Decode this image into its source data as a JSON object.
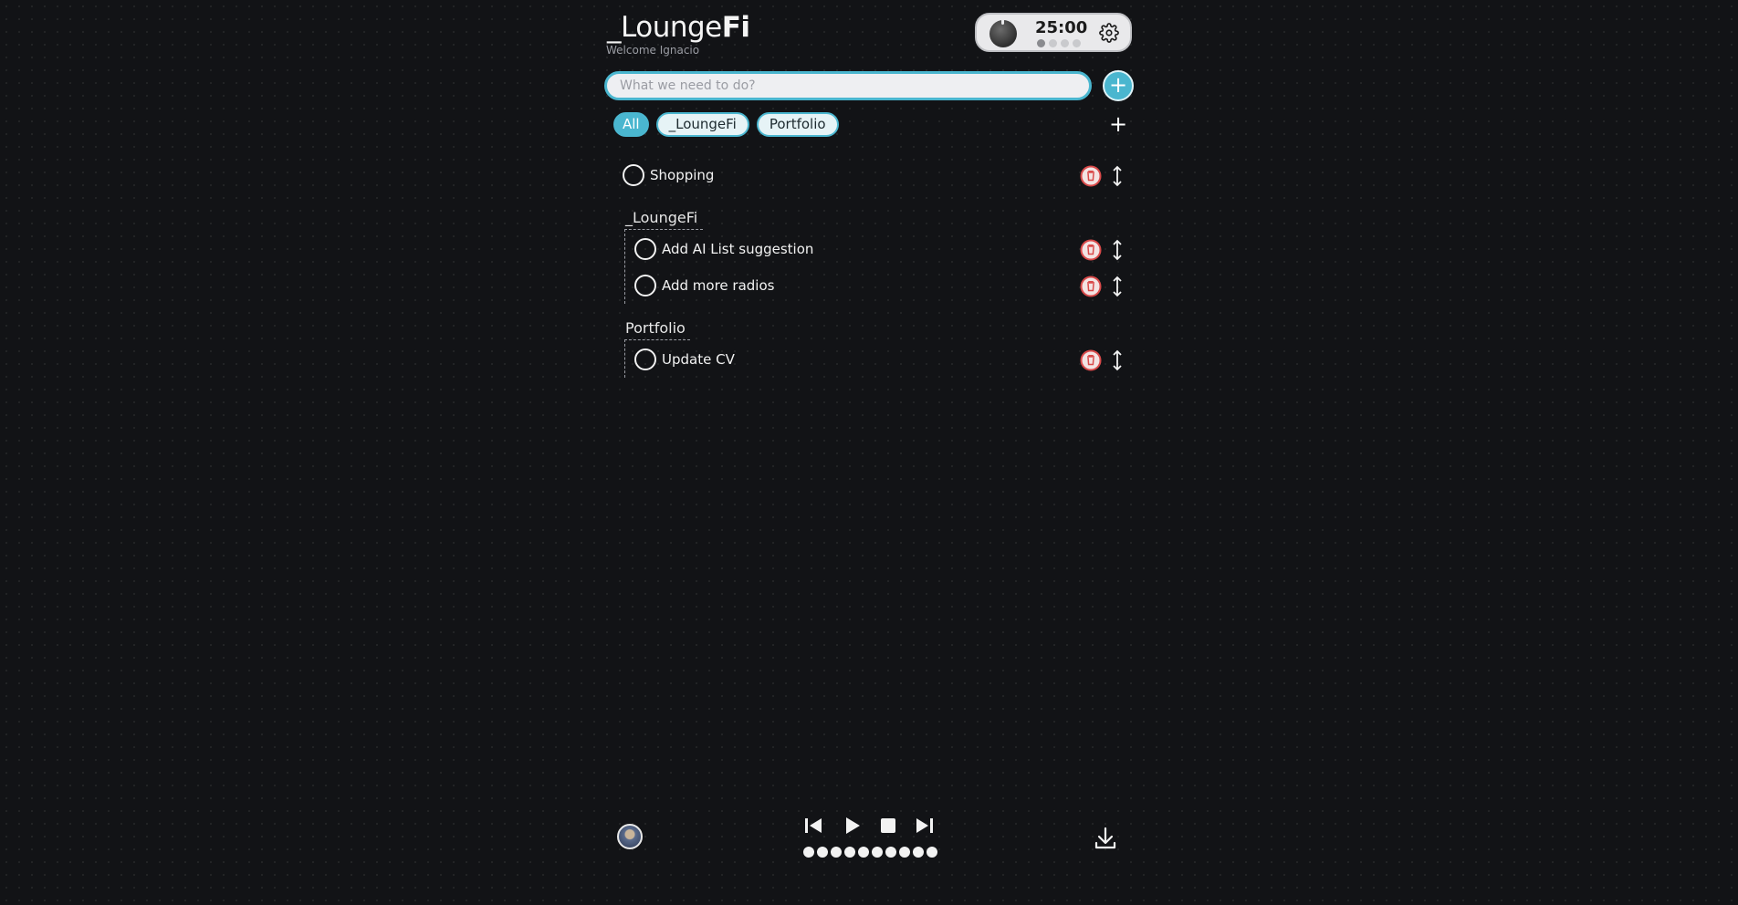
{
  "header": {
    "logo_prefix": "_Lounge",
    "logo_suffix": "Fi",
    "welcome": "Welcome Ignacio"
  },
  "timer": {
    "time": "25:00",
    "sessions_total": 4,
    "sessions_active": 1
  },
  "input": {
    "placeholder": "What we need to do?"
  },
  "tabs": [
    {
      "label": "All",
      "active": true
    },
    {
      "label": "_LoungeFi",
      "active": false
    },
    {
      "label": "Portfolio",
      "active": false
    }
  ],
  "tasks": {
    "ungrouped": [
      {
        "label": "Shopping"
      }
    ],
    "groups": [
      {
        "title": "_LoungeFi",
        "items": [
          {
            "label": "Add AI List suggestion"
          },
          {
            "label": "Add more radios"
          }
        ]
      },
      {
        "title": "Portfolio",
        "items": [
          {
            "label": "Update CV"
          }
        ]
      }
    ]
  },
  "player": {
    "radio_count": 10
  },
  "colors": {
    "accent": "#4ab6cf",
    "background": "#121316",
    "delete": "#d94a4a"
  },
  "icons": [
    "tomato-icon",
    "gear-icon",
    "plus-icon",
    "trash-icon",
    "drag-arrows-icon",
    "previous-icon",
    "play-icon",
    "stop-icon",
    "next-icon",
    "download-icon"
  ]
}
